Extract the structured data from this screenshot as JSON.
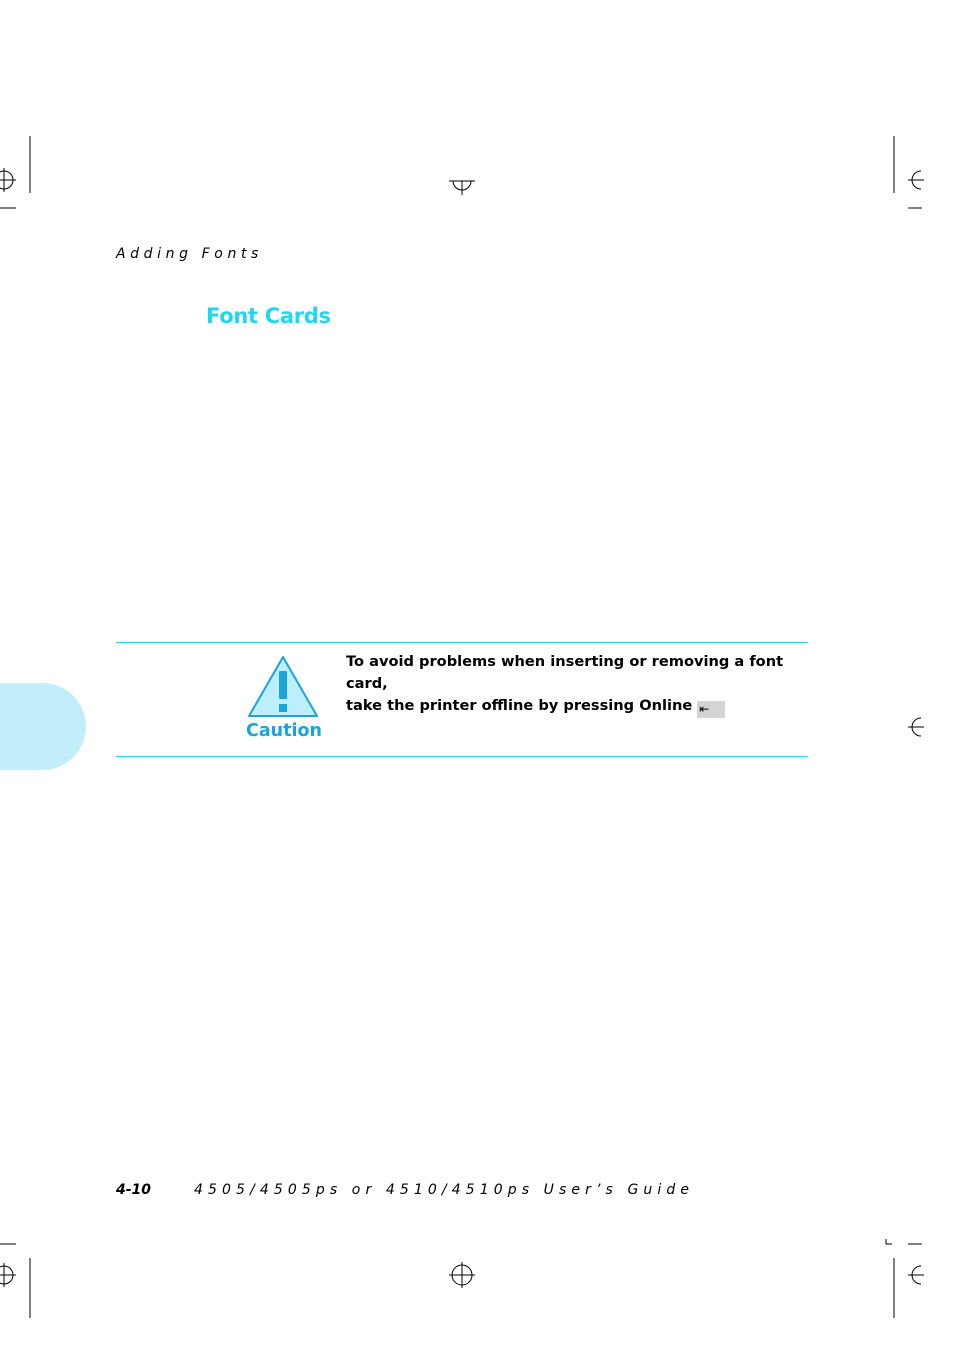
{
  "header": {
    "running_head": "Adding Fonts"
  },
  "section": {
    "title": "Font Cards"
  },
  "caution": {
    "label": "Caution",
    "icon": "caution-triangle-icon",
    "text_line1": "To avoid problems when inserting or removing a font card,",
    "text_line2": "take the printer offline by pressing Online",
    "key_glyph": "⇤"
  },
  "footer": {
    "page_number": "4-10",
    "guide_title": "4505/4505ps or 4510/4510ps User’s Guide"
  },
  "colors": {
    "title": "#1fd8f0",
    "rule": "#29d3ea",
    "tab": "#c2eefa",
    "caution_label": "#1aa4dc",
    "icon_fill": "#bdeefb"
  }
}
